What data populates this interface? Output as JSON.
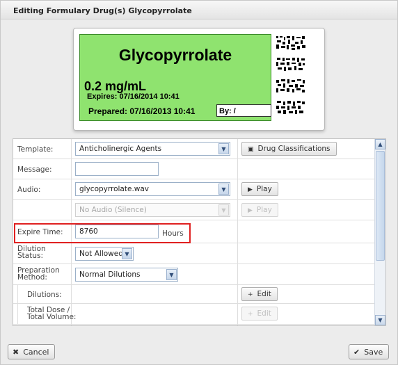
{
  "dialog": {
    "title": "Editing Formulary Drug(s) Glycopyrrolate"
  },
  "label": {
    "drug_name": "Glycopyrrolate",
    "concentration": "0.2 mg/mL",
    "expires": "Expires: 07/16/2014 10:41",
    "prepared": "Prepared: 07/16/2013 10:41",
    "by": "By: /",
    "background_color": "#8fe36f"
  },
  "form": {
    "template": {
      "label": "Template:",
      "value": "Anticholinergic Agents"
    },
    "drug_classifications_button": "Drug Classifications",
    "message": {
      "label": "Message:",
      "value": ""
    },
    "audio": {
      "label": "Audio:",
      "value": "glycopyrrolate.wav"
    },
    "play_button": "Play",
    "audio_secondary": {
      "value": "No Audio (Silence)"
    },
    "play_button_disabled": "Play",
    "expire_time": {
      "label": "Expire Time:",
      "value": "8760",
      "unit": "Hours"
    },
    "dilution_status": {
      "label_line1": "Dilution",
      "label_line2": "Status:",
      "value": "Not Allowed"
    },
    "preparation_method": {
      "label_line1": "Preparation",
      "label_line2": "Method:",
      "value": "Normal Dilutions"
    },
    "dilutions": {
      "label": "Dilutions:"
    },
    "edit_button": "Edit",
    "total_dose": {
      "label_line1": "Total Dose /",
      "label_line2": "Total Volume:"
    },
    "edit_button_disabled": "Edit"
  },
  "footer": {
    "cancel_label": "Cancel",
    "save_label": "Save"
  },
  "icons": {
    "cancel": "x-icon",
    "save": "checkmark-icon",
    "play": "play-icon",
    "edit": "plus-icon",
    "classifications": "image-icon"
  },
  "colors": {
    "highlight": "#e02020",
    "label_green": "#8fe36f"
  }
}
